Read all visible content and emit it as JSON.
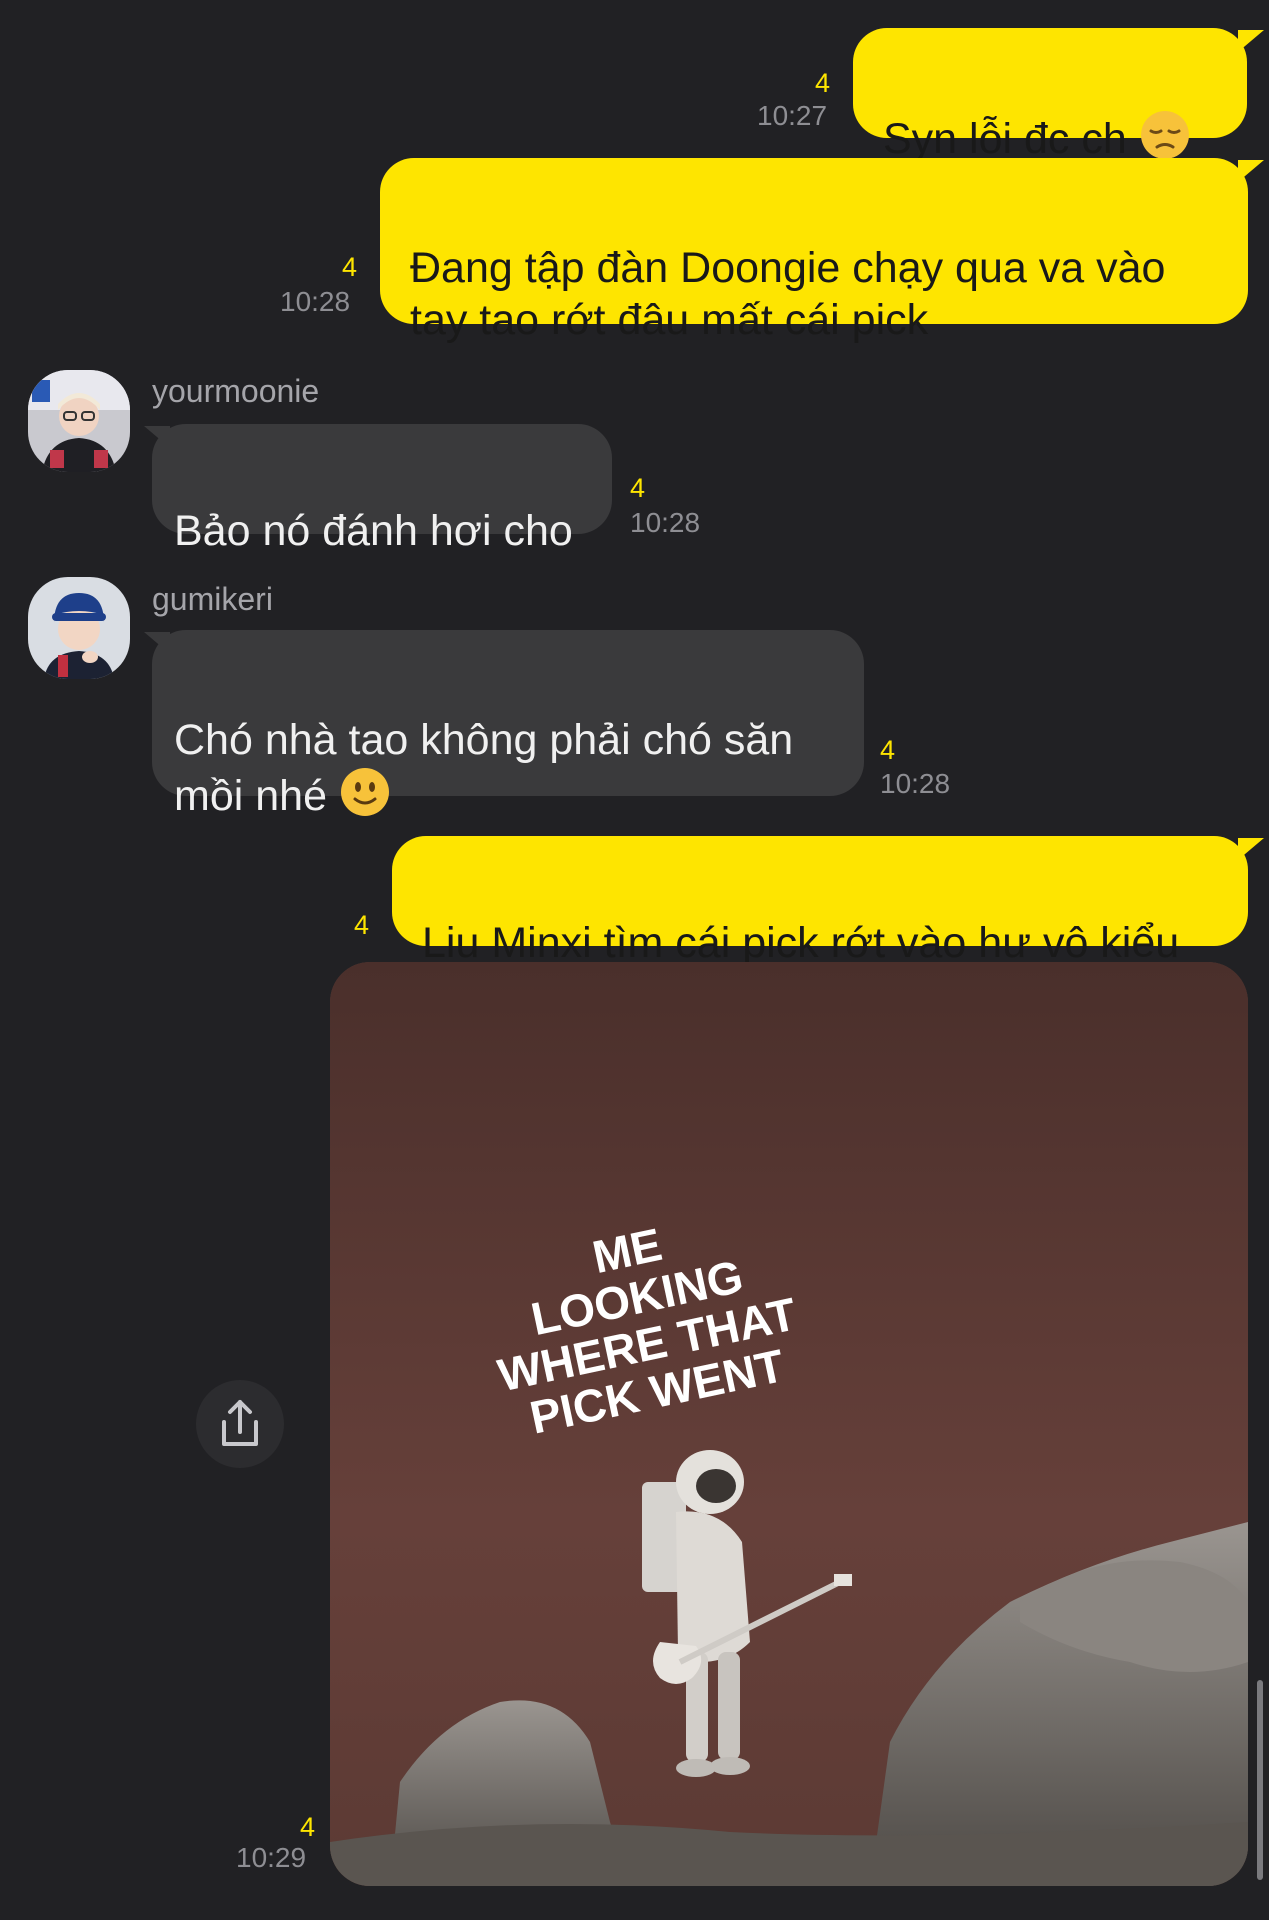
{
  "messages": [
    {
      "direction": "outgoing",
      "text": "Syn lỗi đc ch",
      "emoji": "pensive-face-emoji",
      "unread": "4",
      "time": "10:27"
    },
    {
      "direction": "outgoing",
      "text": "Đang tập đàn Doongie chạy qua va vào\ntay tao rớt đâu mất cái pick",
      "unread": "4",
      "time": "10:28"
    },
    {
      "direction": "incoming",
      "sender": "yourmoonie",
      "avatar": "yourmoonie-avatar",
      "text": "Bảo nó đánh hơi cho",
      "unread": "4",
      "time": "10:28"
    },
    {
      "direction": "incoming",
      "sender": "gumikeri",
      "avatar": "gumikeri-avatar",
      "text": "Chó nhà tao không phải chó săn\nmồi nhé",
      "emoji": "slightly-smiling-face-emoji",
      "unread": "4",
      "time": "10:28"
    },
    {
      "direction": "outgoing",
      "text": "Liu Minxi tìm cái pick rớt vào hư vô kiểu",
      "unread": "4"
    },
    {
      "direction": "outgoing",
      "type": "image",
      "image_caption": "ME\nLOOKING\nWHERE THAT\nPICK WENT",
      "unread": "4",
      "time": "10:29",
      "share_icon": "share-icon"
    }
  ],
  "colors": {
    "background": "#212124",
    "outgoing_bubble": "#fee500",
    "incoming_bubble": "#3a3a3c",
    "unread_count": "#fee500",
    "timestamp": "#8e8e93"
  }
}
